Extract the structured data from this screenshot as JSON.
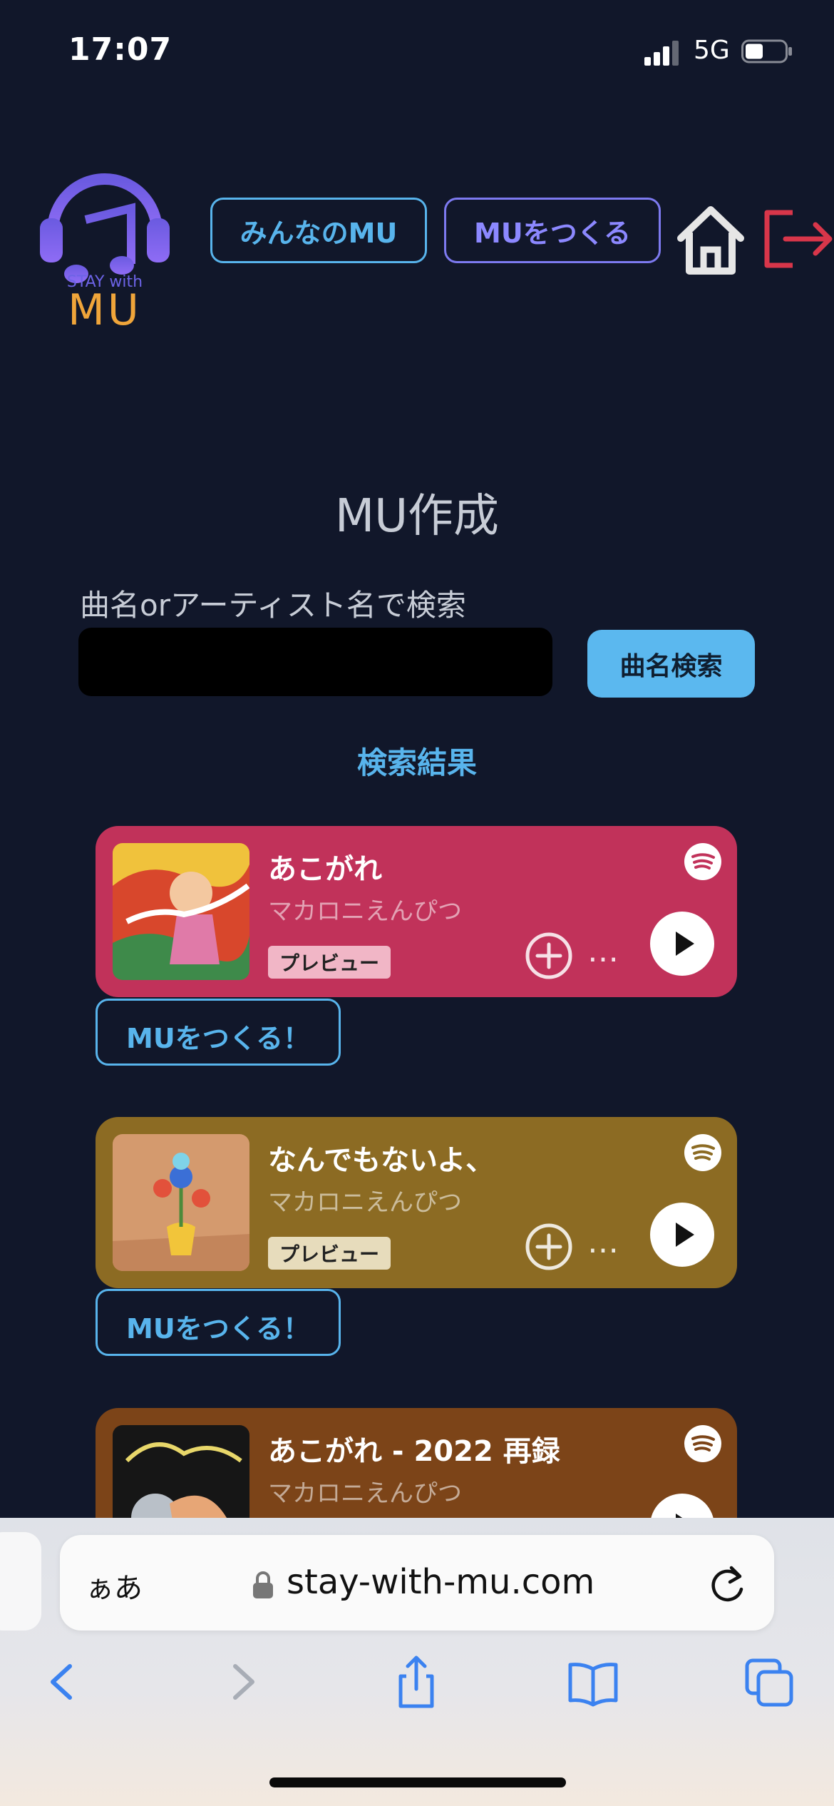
{
  "status_bar": {
    "time": "17:07",
    "network": "5G"
  },
  "header": {
    "logo_tagline": "STAY with",
    "logo_name": "MU",
    "nav_everyone_label": "みんなのMU",
    "nav_create_label": "MUをつくる"
  },
  "main": {
    "title": "MU作成",
    "search_label": "曲名orアーティスト名で検索",
    "search_value": "",
    "search_button_label": "曲名検索",
    "results_heading": "検索結果"
  },
  "results": [
    {
      "title": "あこがれ",
      "artist": "マカロニえんぴつ",
      "preview_label": "プレビュー",
      "more_label": "…",
      "create_label": "MUをつくる！",
      "card_color": "#c1325a"
    },
    {
      "title": "なんでもないよ、",
      "artist": "マカロニえんぴつ",
      "preview_label": "プレビュー",
      "more_label": "…",
      "create_label": "MUをつくる！",
      "card_color": "#8c6b23"
    },
    {
      "title": "あこがれ - 2022 再録",
      "artist": "マカロニえんぴつ",
      "card_color": "#7c4418"
    }
  ],
  "browser": {
    "text_size_label": "ぁあ",
    "url": "stay-with-mu.com"
  },
  "icons": {
    "header": [
      "headphones-music-logo",
      "home-icon",
      "logout-icon"
    ],
    "card": [
      "spotify-icon",
      "add-circle-icon",
      "more-icon",
      "play-icon"
    ],
    "toolbar": [
      "back-icon",
      "forward-icon",
      "share-icon",
      "bookmarks-icon",
      "tabs-icon"
    ]
  }
}
